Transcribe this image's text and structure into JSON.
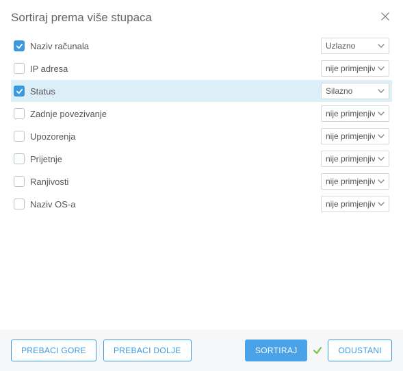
{
  "dialog": {
    "title": "Sortiraj prema više stupaca"
  },
  "options": {
    "ascending": "Uzlazno",
    "descending": "Silazno",
    "not_applicable": "nije primjenjivo"
  },
  "rows": [
    {
      "label": "Naziv računala",
      "checked": true,
      "value": "Uzlazno",
      "highlighted": false
    },
    {
      "label": "IP adresa",
      "checked": false,
      "value": "nije primjenjivo",
      "highlighted": false
    },
    {
      "label": "Status",
      "checked": true,
      "value": "Silazno",
      "highlighted": true
    },
    {
      "label": "Zadnje povezivanje",
      "checked": false,
      "value": "nije primjenjivo",
      "highlighted": false
    },
    {
      "label": "Upozorenja",
      "checked": false,
      "value": "nije primjenjivo",
      "highlighted": false
    },
    {
      "label": "Prijetnje",
      "checked": false,
      "value": "nije primjenjivo",
      "highlighted": false
    },
    {
      "label": "Ranjivosti",
      "checked": false,
      "value": "nije primjenjivo",
      "highlighted": false
    },
    {
      "label": "Naziv OS-a",
      "checked": false,
      "value": "nije primjenjivo",
      "highlighted": false
    }
  ],
  "footer": {
    "move_up": "PREBACI GORE",
    "move_down": "PREBACI DOLJE",
    "sort": "SORTIRAJ",
    "cancel": "ODUSTANI"
  }
}
